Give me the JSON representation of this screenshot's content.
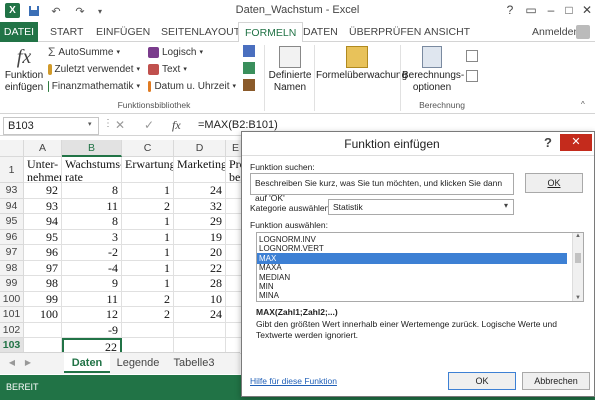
{
  "window": {
    "title": "Daten_Wachstum - Excel",
    "help": "?",
    "min": "–",
    "max": "□",
    "close": "✕"
  },
  "qat": {
    "undo": "↶",
    "redo": "↷"
  },
  "tabs": [
    {
      "label": "DATEI"
    },
    {
      "label": "START"
    },
    {
      "label": "EINFÜGEN"
    },
    {
      "label": "SEITENLAYOUT"
    },
    {
      "label": "FORMELN"
    },
    {
      "label": "DATEN"
    },
    {
      "label": "ÜBERPRÜFEN"
    },
    {
      "label": "ANSICHT"
    }
  ],
  "user": "Anmelden",
  "ribbon": {
    "insert_function": {
      "line1": "Funktion",
      "line2": "einfügen",
      "icon": "fx"
    },
    "library": [
      {
        "label": "AutoSumme",
        "color": "#555555"
      },
      {
        "label": "Zuletzt verwendet",
        "color": "#d19a2a"
      },
      {
        "label": "Finanzmathematik",
        "color": "#2d7a3e"
      },
      {
        "label": "Logisch",
        "color": "#7a3c8c"
      },
      {
        "label": "Text",
        "color": "#c0504d"
      },
      {
        "label": "Datum u. Uhrzeit",
        "color": "#e07b22"
      }
    ],
    "library_label": "Funktionsbibliothek",
    "defined_names": {
      "line1": "Definierte",
      "line2": "Namen"
    },
    "audit": "Formelüberwachung",
    "calc": {
      "line1": "Berechnungs-",
      "line2": "optionen"
    },
    "calc_label": "Berechnung"
  },
  "formulabar": {
    "namebox": "B103",
    "cancel": "✕",
    "enter": "✓",
    "fx": "fx",
    "formula": "=MAX(B2:B101)"
  },
  "grid": {
    "columns": [
      "A",
      "B",
      "C",
      "D",
      "E"
    ],
    "selected_col": "B",
    "header_row": [
      "Unter-nehmen",
      "Wachstums-rate",
      "Erwartung",
      "Marketing",
      "Pro-bes"
    ],
    "rows": [
      {
        "n": "93",
        "a": "92",
        "b": "8",
        "c": "1",
        "d": "24"
      },
      {
        "n": "94",
        "a": "93",
        "b": "11",
        "c": "2",
        "d": "32"
      },
      {
        "n": "95",
        "a": "94",
        "b": "8",
        "c": "1",
        "d": "29"
      },
      {
        "n": "96",
        "a": "95",
        "b": "3",
        "c": "1",
        "d": "19"
      },
      {
        "n": "97",
        "a": "96",
        "b": "-2",
        "c": "1",
        "d": "20"
      },
      {
        "n": "98",
        "a": "97",
        "b": "-4",
        "c": "1",
        "d": "22"
      },
      {
        "n": "99",
        "a": "98",
        "b": "9",
        "c": "1",
        "d": "28"
      },
      {
        "n": "100",
        "a": "99",
        "b": "11",
        "c": "2",
        "d": "10"
      },
      {
        "n": "101",
        "a": "100",
        "b": "12",
        "c": "2",
        "d": "24"
      },
      {
        "n": "102",
        "a": "",
        "b": "-9",
        "c": "",
        "d": ""
      },
      {
        "n": "103",
        "a": "",
        "b": "22",
        "c": "",
        "d": ""
      }
    ],
    "selected_row": "103"
  },
  "sheets": {
    "nav_prev": "◀",
    "nav_next": "▶",
    "tabs": [
      "Daten",
      "Legende",
      "Tabelle3"
    ],
    "active": "Daten"
  },
  "status": "BEREIT",
  "dialog": {
    "title": "Funktion einfügen",
    "help": "?",
    "close": "✕",
    "search_label": "Funktion suchen:",
    "search_value": "Beschreiben Sie kurz, was Sie tun möchten, und klicken Sie dann auf 'OK'",
    "ok_top": "OK",
    "category_label": "Kategorie auswählen:",
    "category_value": "Statistik",
    "select_label": "Funktion auswählen:",
    "functions": [
      "LOGNORM.INV",
      "LOGNORM.VERT",
      "MAX",
      "MAXA",
      "MEDIAN",
      "MIN",
      "MINA"
    ],
    "selected_function": "MAX",
    "signature": "MAX(Zahl1;Zahl2;...)",
    "description": "Gibt den größten Wert innerhalb einer Wertemenge zurück. Logische Werte und Textwerte werden ignoriert.",
    "help_link": "Hilfe für diese Funktion",
    "ok": "OK",
    "cancel": "Abbrechen"
  }
}
